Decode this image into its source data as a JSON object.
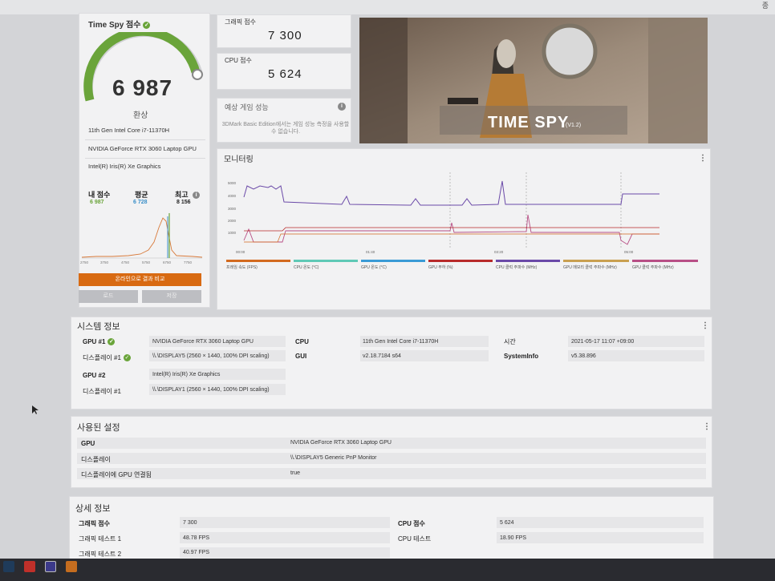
{
  "top": {
    "corner": "종"
  },
  "score_card": {
    "title": "Time Spy 점수",
    "score": "6 987",
    "subtitle": "환상",
    "hardware": [
      "11th Gen Intel Core i7-11370H",
      "NVIDIA GeForce RTX 3060 Laptop GPU",
      "Intel(R) Iris(R) Xe Graphics"
    ],
    "stats": [
      {
        "label": "내 점수",
        "value": "6 987",
        "color": "#6aa43a"
      },
      {
        "label": "평균",
        "value": "6 728",
        "color": "#3a8fc8"
      },
      {
        "label": "최고",
        "value": "8 156",
        "color": "#222222"
      }
    ],
    "gauge_fraction": 0.86,
    "hist_axis": [
      "2750",
      "3750",
      "4750",
      "5750",
      "6750",
      "7750"
    ],
    "compare_button": "온라인으로 결과 비교",
    "btn_left": "로드",
    "btn_right": "저장"
  },
  "graphics_score": {
    "label": "그래픽 점수",
    "value": "7 300"
  },
  "cpu_score": {
    "label": "CPU 점수",
    "value": "5 624"
  },
  "estimate": {
    "label": "예상 게임 성능",
    "text": "3DMark Basic Edition에서는 게임 성능 측정을 사용할 수 없습니다."
  },
  "hero": {
    "title": "TIME SPY",
    "version": "(V1.2)"
  },
  "monitoring": {
    "title": "모니터링",
    "x_ticks": [
      "00:00",
      "01:40",
      "03:20",
      "05:00"
    ],
    "y_ticks": [
      "5000",
      "4000",
      "3000",
      "2000",
      "1000"
    ],
    "legend": [
      {
        "label": "프레임 속도 (FPS)",
        "color": "#d36a1f"
      },
      {
        "label": "CPU 온도 (°C)",
        "color": "#5fc9b6"
      },
      {
        "label": "GPU 온도 (°C)",
        "color": "#3a9bd6"
      },
      {
        "label": "GPU 부하 (%)",
        "color": "#b82a2a"
      },
      {
        "label": "CPU 클럭 주파수 (MHz)",
        "color": "#6b4aa8"
      },
      {
        "label": "GPU 메모리 클럭 주파수 (MHz)",
        "color": "#c9a050"
      },
      {
        "label": "GPU 클럭 주파수 (MHz)",
        "color": "#b84f86"
      }
    ]
  },
  "system_info": {
    "title": "시스템 정보",
    "rows": [
      {
        "label": "GPU #1",
        "value": "NVIDIA GeForce RTX 3060 Laptop GPU"
      },
      {
        "label": "디스플레이 #1",
        "value": "\\\\.\\DISPLAY5 (2560 × 1440, 100% DPI scaling)"
      },
      {
        "label": "GPU #2",
        "value": "Intel(R) Iris(R) Xe Graphics"
      },
      {
        "label": "디스플레이 #1",
        "value": "\\\\.\\DISPLAY1 (2560 × 1440, 100% DPI scaling)"
      }
    ],
    "mid": [
      {
        "label": "CPU",
        "value": "11th Gen Intel Core i7-11370H"
      },
      {
        "label": "GUI",
        "value": "v2.18.7184 s64"
      }
    ],
    "right": [
      {
        "label": "시간",
        "value": "2021-05-17 11:07 +09:00"
      },
      {
        "label": "SystemInfo",
        "value": "v5.38.896"
      }
    ]
  },
  "settings": {
    "title": "사용된 설정",
    "rows": [
      {
        "label": "GPU",
        "value": "NVIDIA GeForce RTX 3060 Laptop GPU"
      },
      {
        "label": "디스플레이",
        "value": "\\\\.\\DISPLAY5 Generic PnP Monitor"
      },
      {
        "label": "디스플레이에 GPU 연결됨",
        "value": "true"
      }
    ]
  },
  "details": {
    "title": "상세 정보",
    "left": [
      {
        "label": "그래픽 점수",
        "value": "7 300"
      },
      {
        "label": "그래픽 테스트 1",
        "value": "48.78 FPS"
      },
      {
        "label": "그래픽 테스트 2",
        "value": "40.97 FPS"
      }
    ],
    "right": [
      {
        "label": "CPU 점수",
        "value": "5 624"
      },
      {
        "label": "CPU 테스트",
        "value": "18.90 FPS"
      }
    ]
  },
  "colors": {
    "accent": "#d86a12",
    "gauge": "#6aa43a"
  }
}
